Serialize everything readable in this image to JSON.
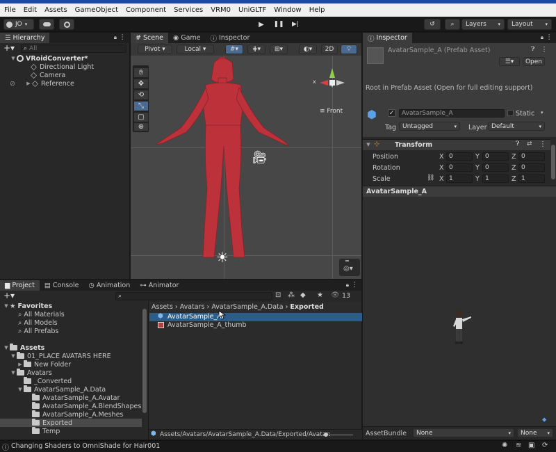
{
  "menu": [
    "File",
    "Edit",
    "Assets",
    "GameObject",
    "Component",
    "Services",
    "VRM0",
    "UniGLTF",
    "Window",
    "Help"
  ],
  "toolbar": {
    "account": "JO",
    "layers": "Layers",
    "layout": "Layout"
  },
  "hierarchy": {
    "tab": "Hierarchy",
    "search_placeholder": "All",
    "items": [
      {
        "label": "VRoidConverter*"
      },
      {
        "label": "Directional Light"
      },
      {
        "label": "Camera"
      },
      {
        "label": "Reference"
      }
    ]
  },
  "scene": {
    "tabs": [
      {
        "label": "Scene"
      },
      {
        "label": "Game"
      },
      {
        "label": "Inspector"
      }
    ],
    "pivot": "Pivot",
    "local": "Local",
    "mode2d": "2D",
    "gizmo": {
      "x": "x",
      "front": "Front"
    }
  },
  "inspector": {
    "tab": "Inspector",
    "title": "AvatarSample_A (Prefab Asset)",
    "open": "Open",
    "root_note": "Root in Prefab Asset (Open for full editing support)",
    "object_name": "AvatarSample_A",
    "static": "Static",
    "tag_label": "Tag",
    "tag_value": "Untagged",
    "layer_label": "Layer",
    "layer_value": "Default",
    "transform": "Transform",
    "rows": [
      {
        "label": "Position",
        "x": "0",
        "y": "0",
        "z": "0"
      },
      {
        "label": "Rotation",
        "x": "0",
        "y": "0",
        "z": "0"
      },
      {
        "label": "Scale",
        "x": "1",
        "y": "1",
        "z": "1"
      }
    ],
    "axis": {
      "x": "X",
      "y": "Y",
      "z": "Z"
    },
    "preview_title": "AvatarSample_A",
    "assetbundle_label": "AssetBundle",
    "assetbundle_value": "None",
    "assetbundle_variant": "None"
  },
  "bottom_tabs": [
    {
      "label": "Project"
    },
    {
      "label": "Console"
    },
    {
      "label": "Animation"
    },
    {
      "label": "Animator"
    }
  ],
  "project": {
    "count": "13",
    "favorites": {
      "title": "Favorites",
      "items": [
        "All Materials",
        "All Models",
        "All Prefabs"
      ]
    },
    "tree": [
      {
        "label": "Assets",
        "depth": 0
      },
      {
        "label": "01_PLACE AVATARS HERE",
        "depth": 1
      },
      {
        "label": "New Folder",
        "depth": 2
      },
      {
        "label": "Avatars",
        "depth": 1
      },
      {
        "label": "_Converted",
        "depth": 2
      },
      {
        "label": "AvatarSample_A.Data",
        "depth": 2
      },
      {
        "label": "AvatarSample_A.Avatar",
        "depth": 3
      },
      {
        "label": "AvatarSample_A.BlendShapes",
        "depth": 3
      },
      {
        "label": "AvatarSample_A.Meshes",
        "depth": 3
      },
      {
        "label": "Exported",
        "depth": 3
      },
      {
        "label": "Temp",
        "depth": 3
      }
    ],
    "breadcrumb": [
      "Assets",
      "Avatars",
      "AvatarSample_A.Data",
      "Exported"
    ],
    "files": [
      {
        "label": "AvatarSample_A"
      },
      {
        "label": "AvatarSample_A_thumb"
      }
    ],
    "path": "Assets/Avatars/AvatarSample_A.Data/Exported/Avatar:"
  },
  "status": "Changing Shaders to OmniShade for Hair001"
}
